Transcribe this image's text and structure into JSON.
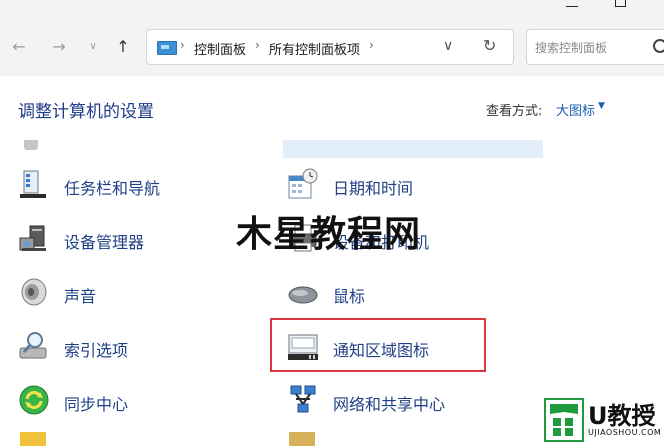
{
  "address_bar": {
    "crumbs": [
      "控制面板",
      "所有控制面板项"
    ],
    "search_placeholder": "搜索控制面板"
  },
  "header": {
    "title": "调整计算机的设置",
    "view_by_label": "查看方式:",
    "view_mode": "大图标"
  },
  "items_left": [
    {
      "label": "任务栏和导航",
      "icon": "taskbar-icon"
    },
    {
      "label": "设备管理器",
      "icon": "device-manager-icon"
    },
    {
      "label": "声音",
      "icon": "speaker-icon"
    },
    {
      "label": "索引选项",
      "icon": "indexing-icon"
    },
    {
      "label": "同步中心",
      "icon": "sync-icon"
    }
  ],
  "items_right": [
    {
      "label": "日期和时间",
      "icon": "calendar-clock-icon"
    },
    {
      "label": "设备和打印机",
      "icon": "printer-icon"
    },
    {
      "label": "鼠标",
      "icon": "mouse-icon"
    },
    {
      "label": "通知区域图标",
      "icon": "notification-area-icon"
    },
    {
      "label": "网络和共享中心",
      "icon": "network-icon"
    }
  ],
  "watermark": "木星教程网",
  "logo": {
    "brand": "U教授",
    "url": "UJIAOSHOU.COM"
  },
  "colors": {
    "link": "#1f3f86",
    "highlight_border": "#d7393f",
    "logo_green": "#1f9a3c"
  }
}
